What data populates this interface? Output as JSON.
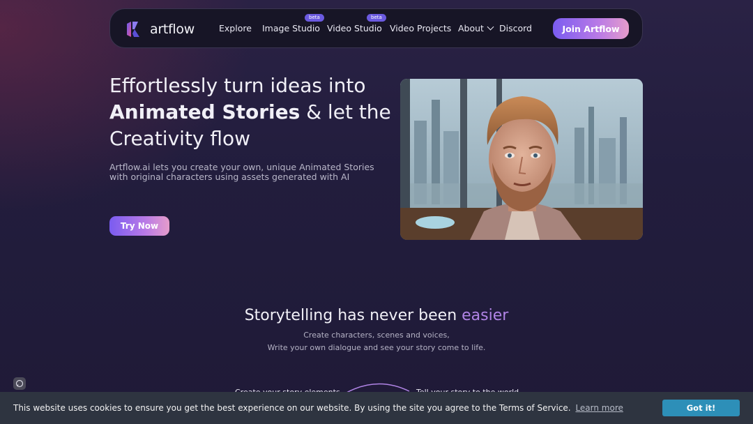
{
  "nav": {
    "logo_text": "artflow",
    "items": [
      {
        "label": "Explore"
      },
      {
        "label": "Image Studio",
        "badge": "beta"
      },
      {
        "label": "Video Studio",
        "badge": "beta"
      },
      {
        "label": "Video Projects"
      },
      {
        "label": "About"
      },
      {
        "label": "Discord"
      }
    ],
    "join_label": "Join Artflow"
  },
  "hero": {
    "title_line1": "Effortlessly turn ideas into",
    "title_bold": "Animated Stories",
    "title_rest": " & let the",
    "title_line3": "Creativity flow",
    "subtitle": "Artflow.ai lets you create your own, unique Animated Stories with original characters using assets generated with AI",
    "cta_label": "Try Now"
  },
  "section": {
    "title_main": "Storytelling has never been ",
    "title_accent": "easier",
    "line1": "Create characters, scenes and voices,",
    "line2": "Write your own dialogue and see your story come to life.",
    "step1": "Create your story elements",
    "step2": "Tell your story to the world"
  },
  "cookie": {
    "text": "This website uses cookies to ensure you get the best experience on our website. By using the site you agree to the Terms of Service.",
    "link": "Learn more",
    "button": "Got it!"
  },
  "colors": {
    "accent": "#b184e6",
    "button_gradient_start": "#7a5cf0",
    "button_gradient_end": "#e59ccb",
    "cookie_button": "#2d8fb8"
  }
}
